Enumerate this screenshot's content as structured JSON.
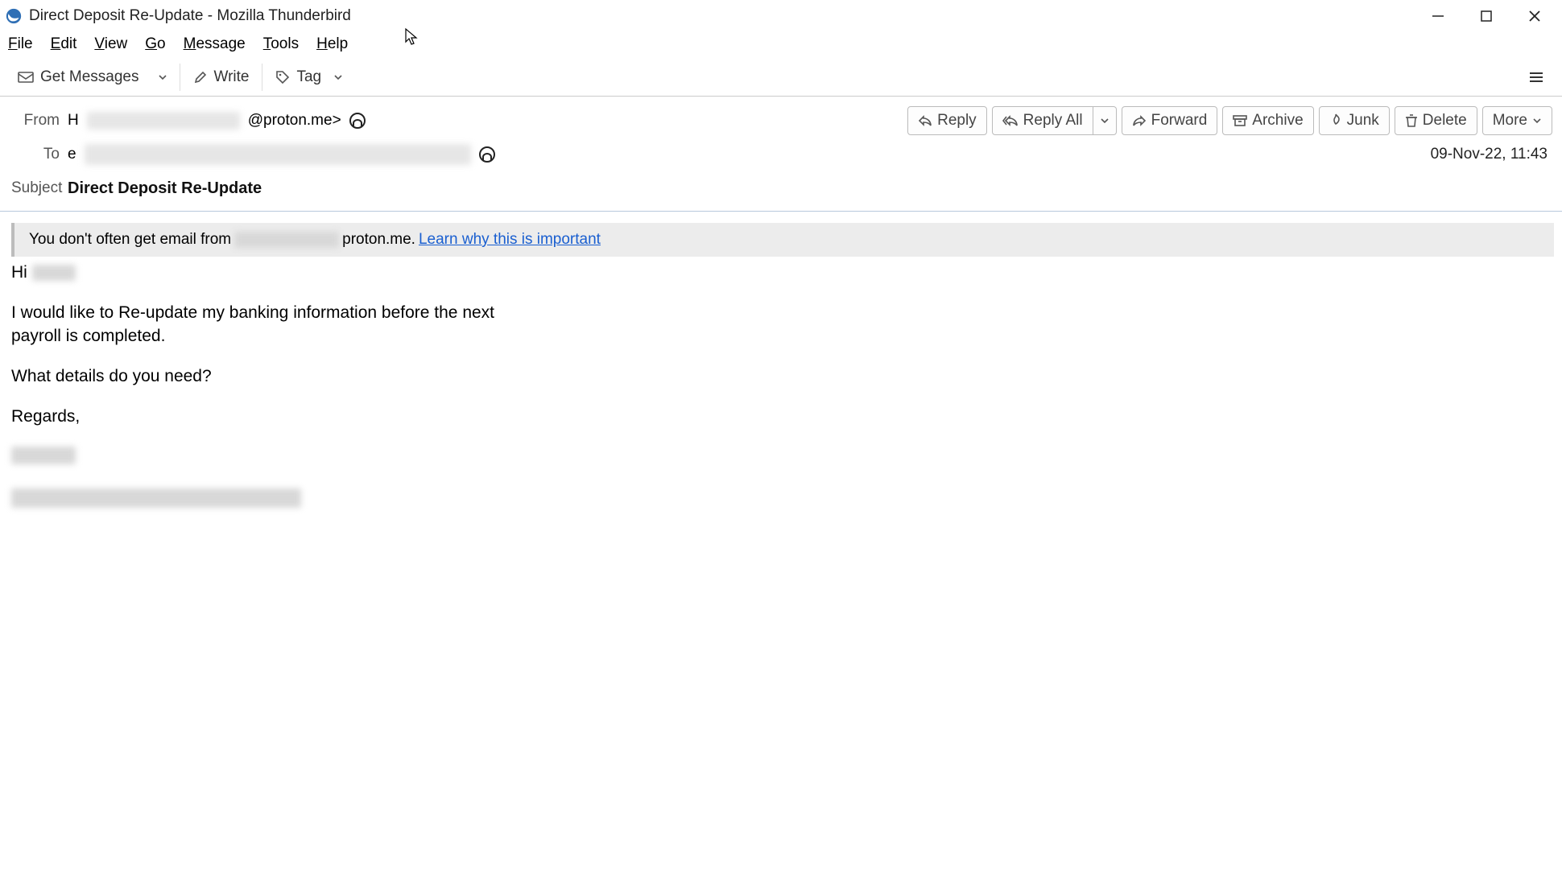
{
  "window": {
    "title": "Direct Deposit Re-Update - Mozilla Thunderbird"
  },
  "menubar": {
    "file": "File",
    "edit": "Edit",
    "view": "View",
    "go": "Go",
    "message": "Message",
    "tools": "Tools",
    "help": "Help"
  },
  "toolbar": {
    "get_messages": "Get Messages",
    "write": "Write",
    "tag": "Tag"
  },
  "header": {
    "from_label": "From",
    "from_value_prefix": "H",
    "from_value_suffix": "@proton.me>",
    "to_label": "To",
    "to_value_prefix": "e",
    "subject_label": "Subject",
    "subject_value": "Direct Deposit Re-Update",
    "datetime": "09-Nov-22, 11:43"
  },
  "actions": {
    "reply": "Reply",
    "reply_all": "Reply All",
    "forward": "Forward",
    "archive": "Archive",
    "junk": "Junk",
    "delete": "Delete",
    "more": "More"
  },
  "infobar": {
    "prefix": "You don't often get email from ",
    "domain_suffix": "proton.me. ",
    "link": "Learn why this is important"
  },
  "body": {
    "greeting_prefix": "Hi ",
    "para1": "I would like to Re-update my banking information before the next payroll is completed.",
    "para2": "What details do you need?",
    "closing": "Regards,"
  }
}
